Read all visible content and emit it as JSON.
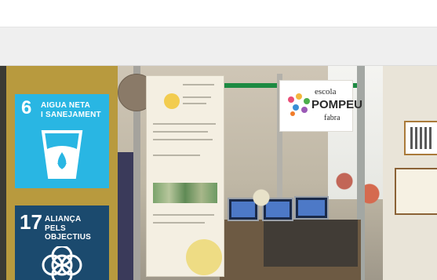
{
  "sdg_tiles": [
    {
      "number": "6",
      "line1": "AIGUA NETA",
      "line2": "I SANEJAMENT",
      "color": "#29b6e3"
    },
    {
      "number": "17",
      "line1": "ALIANÇA",
      "line2": "PELS OBJECTIUS",
      "color": "#1b4a6e"
    }
  ],
  "booth": {
    "logo_line1": "escola",
    "logo_line2": "POMPEU",
    "logo_line3": "fabra"
  },
  "colors": {
    "gold_panel": "#b89a3e",
    "beam_green": "#1c8a42"
  }
}
